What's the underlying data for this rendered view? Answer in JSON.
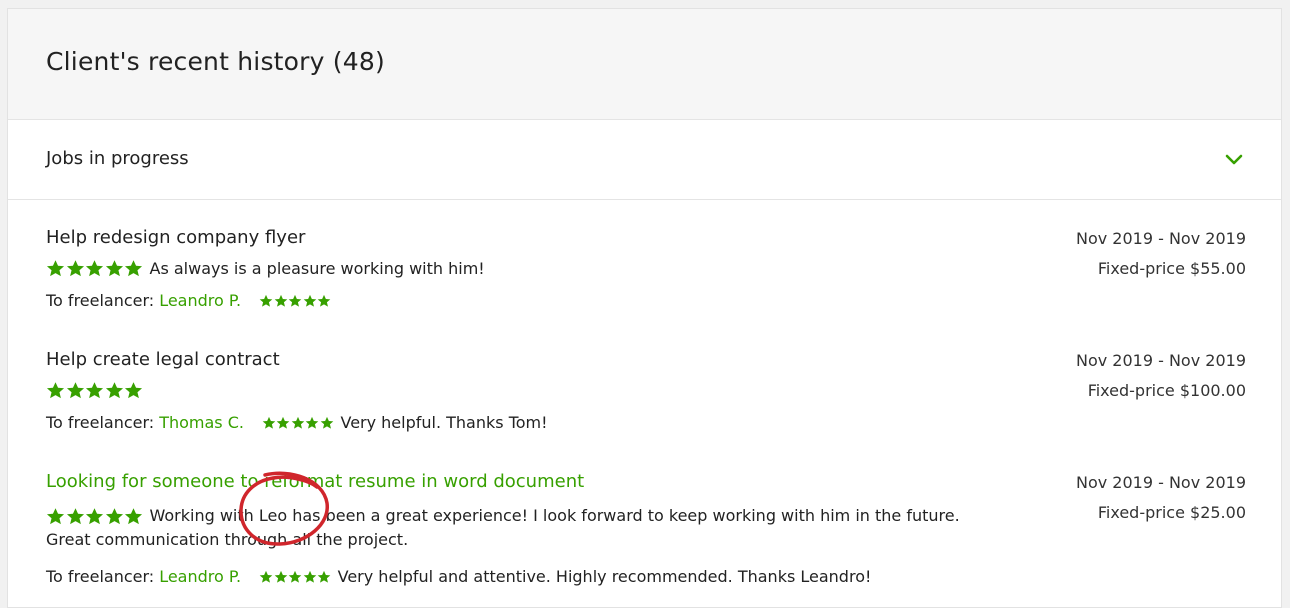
{
  "header": {
    "title": "Client's recent history (48)"
  },
  "section": {
    "label": "Jobs in progress",
    "icon": "chevron-down-icon"
  },
  "colors": {
    "accent": "#37a000",
    "annotation": "#d0262c"
  },
  "jobs": [
    {
      "title": "Help redesign company flyer",
      "client_rating": 5,
      "client_comment": "As always is a pleasure working with him!",
      "to_freelancer_label": "To freelancer:",
      "freelancer": "Leandro P.",
      "freelancer_rating": 5,
      "freelancer_comment": "",
      "dates": "Nov 2019 - Nov 2019",
      "price": "Fixed-price $55.00"
    },
    {
      "title": "Help create legal contract",
      "client_rating": 5,
      "client_comment": "",
      "to_freelancer_label": "To freelancer:",
      "freelancer": "Thomas C.",
      "freelancer_rating": 5,
      "freelancer_comment": "Very helpful. Thanks Tom!",
      "dates": "Nov 2019 - Nov 2019",
      "price": "Fixed-price $100.00"
    },
    {
      "title": "Looking for someone to reformat resume in word document",
      "client_rating": 5,
      "client_comment_line1": "Working with Leo has been a great experience! I look forward to keep working with him in the future.",
      "client_comment_line2": "Great communication through all the project.",
      "to_freelancer_label": "To freelancer:",
      "freelancer": "Leandro P.",
      "freelancer_rating": 5,
      "freelancer_comment": "Very helpful and attentive. Highly recommended. Thanks Leandro!",
      "dates": "Nov 2019 - Nov 2019",
      "price": "Fixed-price $25.00"
    }
  ]
}
